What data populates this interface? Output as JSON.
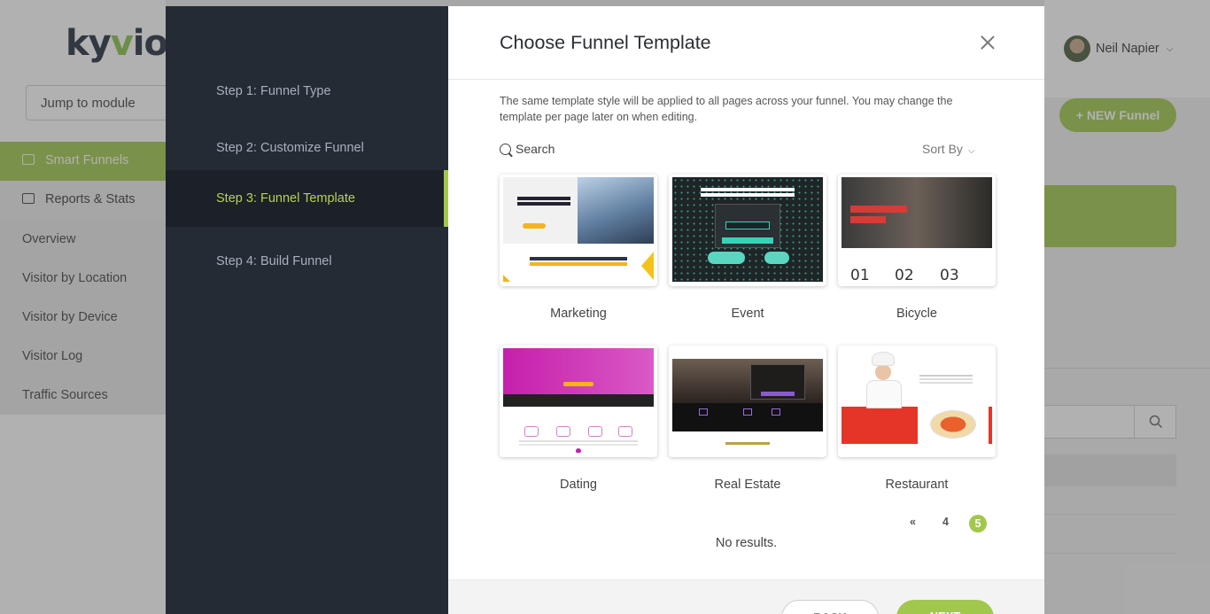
{
  "app": {
    "logo_text": "kyvio",
    "jump_to_module": "Jump to module",
    "nav": {
      "smart_funnels": "Smart Funnels",
      "reports_stats": "Reports & Stats",
      "sub_items": [
        "Overview",
        "Visitor by Location",
        "Visitor by Device",
        "Visitor Log",
        "Traffic Sources"
      ]
    },
    "user_name": "Neil Napier",
    "new_funnel_label": "+ NEW Funnel",
    "accent_color": "#a1c84c"
  },
  "wizard": {
    "steps": [
      {
        "label": "Step 1: Funnel Type",
        "active": false
      },
      {
        "label": "Step 2: Customize Funnel",
        "active": false
      },
      {
        "label": "Step 3: Funnel Template",
        "active": true
      },
      {
        "label": "Step 4: Build Funnel",
        "active": false
      }
    ]
  },
  "modal": {
    "title": "Choose Funnel Template",
    "description": "The same template style will be applied to all pages across your funnel. You may change the template per page later on when editing.",
    "search_label": "Search",
    "sort_label": "Sort By",
    "templates": [
      {
        "name": "Marketing"
      },
      {
        "name": "Event"
      },
      {
        "name": "Bicycle"
      },
      {
        "name": "Dating"
      },
      {
        "name": "Real Estate"
      },
      {
        "name": "Restaurant"
      }
    ],
    "bicycle_counters": [
      "01",
      "02",
      "03"
    ],
    "pagination": {
      "prev": "«",
      "pages": [
        "4",
        "5"
      ],
      "current": "5"
    },
    "no_results": "No results.",
    "back_label": "BACK",
    "next_label": "NEXT"
  }
}
